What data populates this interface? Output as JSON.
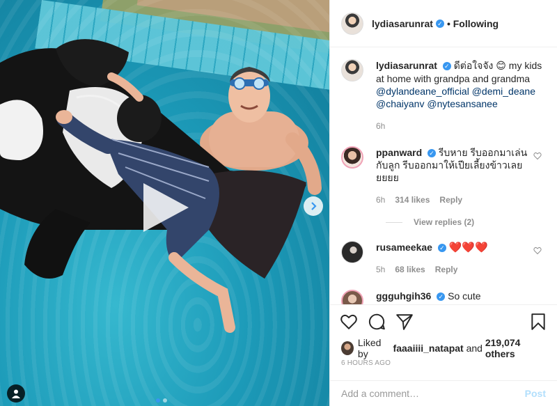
{
  "post": {
    "author": "lydiasarunrat",
    "follow_status": "• Following",
    "caption": {
      "text_thai": "ดีต่อใจจัง",
      "emoji": "😊",
      "text_en": "my kids at home with grandpa and grandma",
      "mentions": [
        "@dylandeane_official",
        "@demi_deane",
        "@chaiyanv",
        "@nytesansanee"
      ],
      "time": "6h"
    }
  },
  "comments": [
    {
      "user": "ppanward",
      "text": "รีบหาย รีบออกมาเล่นกับลูก รีบออกมาให้เปียเลี้ยงข้าวเลย ยยยย",
      "time": "6h",
      "likes": "314 likes",
      "reply": "Reply",
      "view_replies": "View replies (2)"
    },
    {
      "user": "rusameekae",
      "text": "❤️❤️❤️",
      "time": "5h",
      "likes": "68 likes",
      "reply": "Reply"
    },
    {
      "user": "ggguhgih36",
      "text": "So cute"
    }
  ],
  "likes_line": {
    "prefix": "Liked by",
    "user": "faaaiiii_natapat",
    "middle": "and",
    "count": "219,074 others"
  },
  "timestamp": "6 HOURS AGO",
  "composer": {
    "placeholder": "Add a comment…",
    "post_label": "Post"
  },
  "colors": {
    "accent": "#3897f0",
    "like_red": "#e0245e",
    "post_disabled": "#b2dffc"
  },
  "icons": [
    "heart-icon",
    "comment-icon",
    "share-icon",
    "bookmark-icon",
    "play-icon",
    "chevron-right-icon",
    "user-tag-icon",
    "verified-badge-icon"
  ]
}
